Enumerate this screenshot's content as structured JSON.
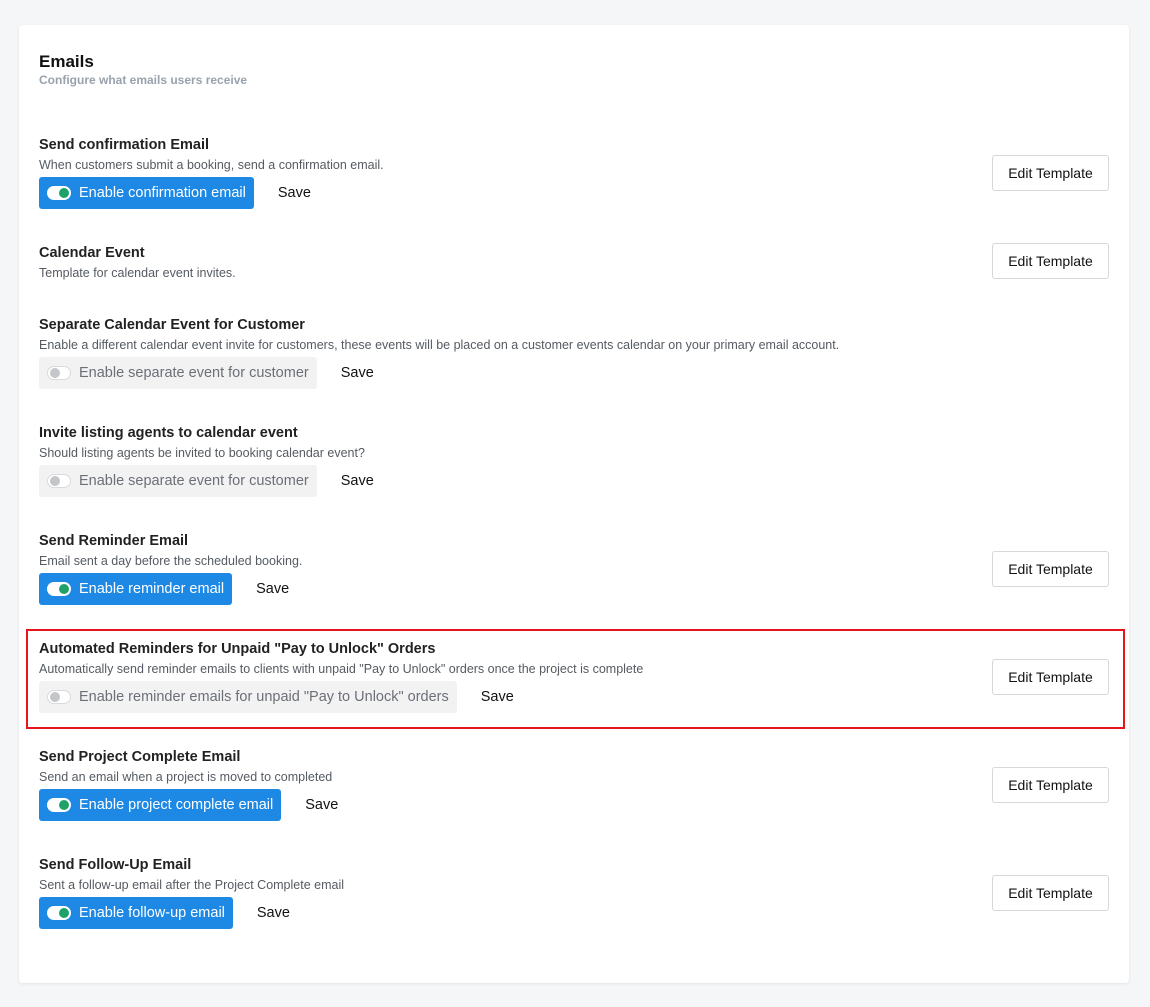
{
  "header": {
    "title": "Emails",
    "subtitle": "Configure what emails users receive"
  },
  "settings": [
    {
      "title": "Send confirmation Email",
      "description": "When customers submit a booking, send a confirmation email.",
      "toggle_label": "Enable confirmation email",
      "enabled": true,
      "save_label": "Save",
      "edit_label": "Edit Template"
    },
    {
      "title": "Calendar Event",
      "description": "Template for calendar event invites.",
      "edit_label": "Edit Template"
    },
    {
      "title": "Separate Calendar Event for Customer",
      "description": "Enable a different calendar event invite for customers, these events will be placed on a customer events calendar on your primary email account.",
      "toggle_label": "Enable separate event for customer",
      "enabled": false,
      "save_label": "Save"
    },
    {
      "title": "Invite listing agents to calendar event",
      "description": "Should listing agents be invited to booking calendar event?",
      "toggle_label": "Enable separate event for customer",
      "enabled": false,
      "save_label": "Save"
    },
    {
      "title": "Send Reminder Email",
      "description": "Email sent a day before the scheduled booking.",
      "toggle_label": "Enable reminder email",
      "enabled": true,
      "save_label": "Save",
      "edit_label": "Edit Template"
    },
    {
      "title": "Automated Reminders for Unpaid \"Pay to Unlock\" Orders",
      "description": "Automatically send reminder emails to clients with unpaid \"Pay to Unlock\" orders once the project is complete",
      "toggle_label": "Enable reminder emails for unpaid \"Pay to Unlock\" orders",
      "enabled": false,
      "save_label": "Save",
      "edit_label": "Edit Template"
    },
    {
      "title": "Send Project Complete Email",
      "description": "Send an email when a project is moved to completed",
      "toggle_label": "Enable project complete email",
      "enabled": true,
      "save_label": "Save",
      "edit_label": "Edit Template"
    },
    {
      "title": "Send Follow-Up Email",
      "description": "Sent a follow-up email after the Project Complete email",
      "toggle_label": "Enable follow-up email",
      "enabled": true,
      "save_label": "Save",
      "edit_label": "Edit Template"
    }
  ],
  "colors": {
    "accent": "#1e88e5",
    "switch_on": "#1fa26a",
    "highlight": "#e8141b"
  }
}
